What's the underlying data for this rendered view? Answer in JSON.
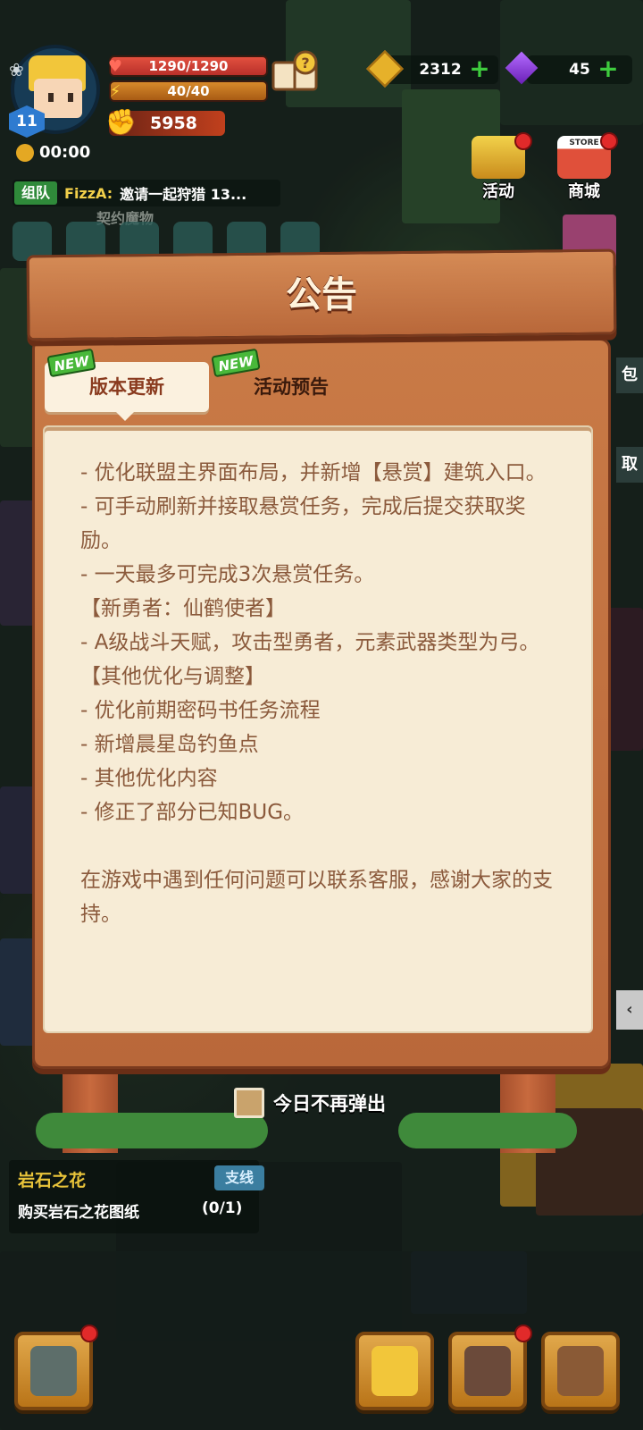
{
  "hud": {
    "level": "11",
    "hp": "1290/1290",
    "energy": "40/40",
    "power": "5958",
    "timer": "00:00",
    "gold": "2312",
    "gems": "45"
  },
  "top_buttons": {
    "activity": "活动",
    "shop": "商城",
    "shop_sign": "STORE"
  },
  "team_bar": {
    "tag": "组队",
    "name": "FizzA:",
    "message": "邀请一起狩猎 13..."
  },
  "contract_label": "契约魔物",
  "dialog": {
    "title": "公告",
    "tabs": [
      {
        "label": "版本更新",
        "badge": "NEW"
      },
      {
        "label": "活动预告",
        "badge": "NEW"
      }
    ],
    "lines": [
      "- 优化联盟主界面布局，并新增【悬赏】建筑入口。",
      "- 可手动刷新并接取悬赏任务，完成后提交获取奖励。",
      "- 一天最多可完成3次悬赏任务。",
      "【新勇者：仙鹤使者】",
      "- A级战斗天赋，攻击型勇者，元素武器类型为弓。",
      "【其他优化与调整】",
      "- 优化前期密码书任务流程",
      "- 新增晨星岛钓鱼点",
      "- 其他优化内容",
      "- 修正了部分已知BUG。"
    ],
    "footer": "在游戏中遇到任何问题可以联系客服，感谢大家的支持。",
    "dont_show_today": "今日不再弹出"
  },
  "quest": {
    "title": "岩石之花",
    "tag": "支线",
    "description": "购买岩石之花图纸",
    "progress": "(0/1)"
  },
  "side_labels": {
    "bag": "包",
    "take": "取"
  },
  "colors": {
    "board": "#c97a46",
    "paper": "#f7ecd6",
    "text_brown": "#8b5a3c",
    "tab_active_text": "#8a3b1f",
    "new_badge": "#49b83a",
    "quest_title": "#e9c43a"
  }
}
